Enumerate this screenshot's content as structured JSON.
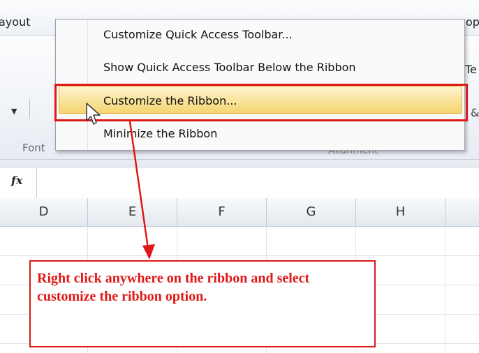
{
  "ribbon": {
    "tab_left": "ayout",
    "tab_right": "op",
    "partial_te": "Te",
    "partial_amp": "&",
    "group_font": "Font",
    "group_alignment": "Alignment"
  },
  "formula_bar": {
    "fx_label": "fx"
  },
  "columns": [
    "D",
    "E",
    "F",
    "G",
    "H"
  ],
  "context_menu": {
    "items": [
      "Customize Quick Access Toolbar...",
      "Show Quick Access Toolbar Below the Ribbon",
      "Customize the Ribbon...",
      "Minimize the Ribbon"
    ],
    "highlighted_index": 2
  },
  "annotation": {
    "text": "Right click anywhere on the ribbon and select customize the ribbon option.",
    "color": "#e01818"
  }
}
